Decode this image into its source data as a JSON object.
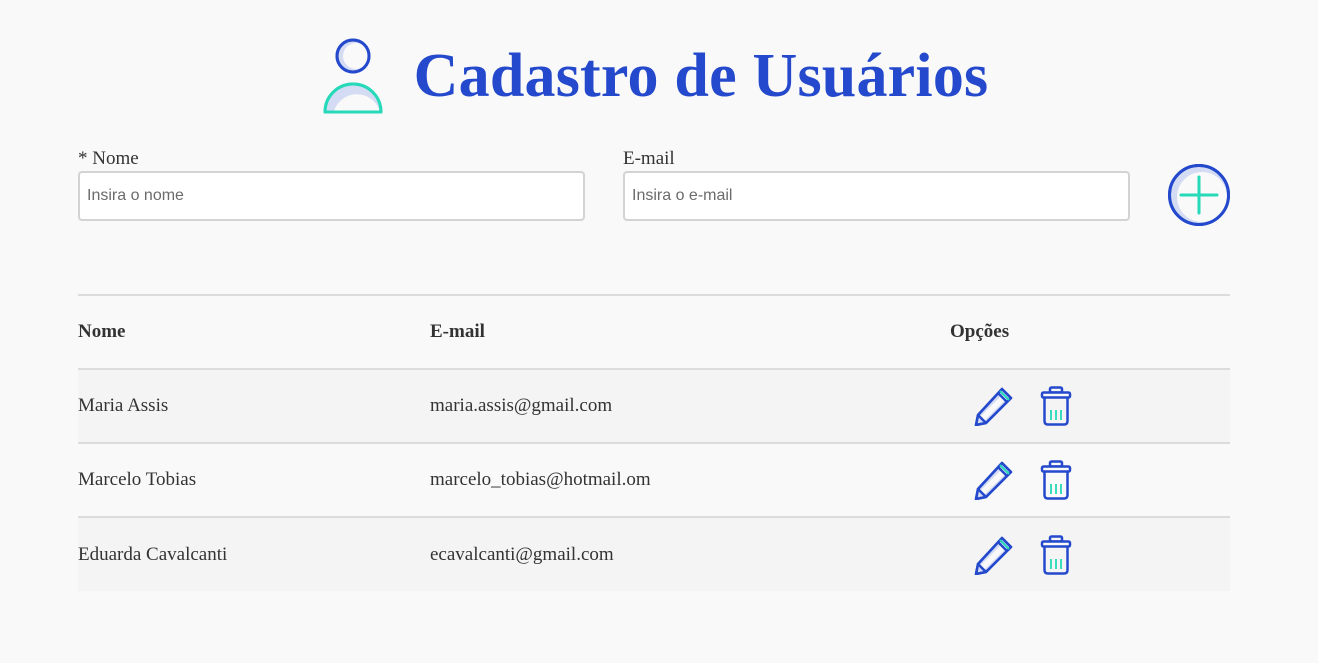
{
  "header": {
    "title": "Cadastro de Usuários",
    "icon": "user-icon"
  },
  "form": {
    "name_label": "* Nome",
    "name_placeholder": "Insira o nome",
    "name_value": "",
    "email_label": "E-mail",
    "email_placeholder": "Insira o e-mail",
    "email_value": "",
    "add_icon": "plus-circle-icon"
  },
  "table": {
    "columns": [
      "Nome",
      "E-mail",
      "Opções"
    ],
    "rows": [
      {
        "name": "Maria Assis",
        "email": "maria.assis@gmail.com"
      },
      {
        "name": "Marcelo Tobias",
        "email": "marcelo_tobias@hotmail.om"
      },
      {
        "name": "Eduarda Cavalcanti",
        "email": "ecavalcanti@gmail.com"
      }
    ],
    "row_actions": [
      "pencil-icon",
      "trash-icon"
    ]
  },
  "colors": {
    "primary": "#2449cc",
    "accent": "#26d9b8",
    "light_fill": "#d4dcf4",
    "background": "#f9f9f9",
    "row_alt": "#f4f4f4",
    "border": "#dcdcdc"
  }
}
